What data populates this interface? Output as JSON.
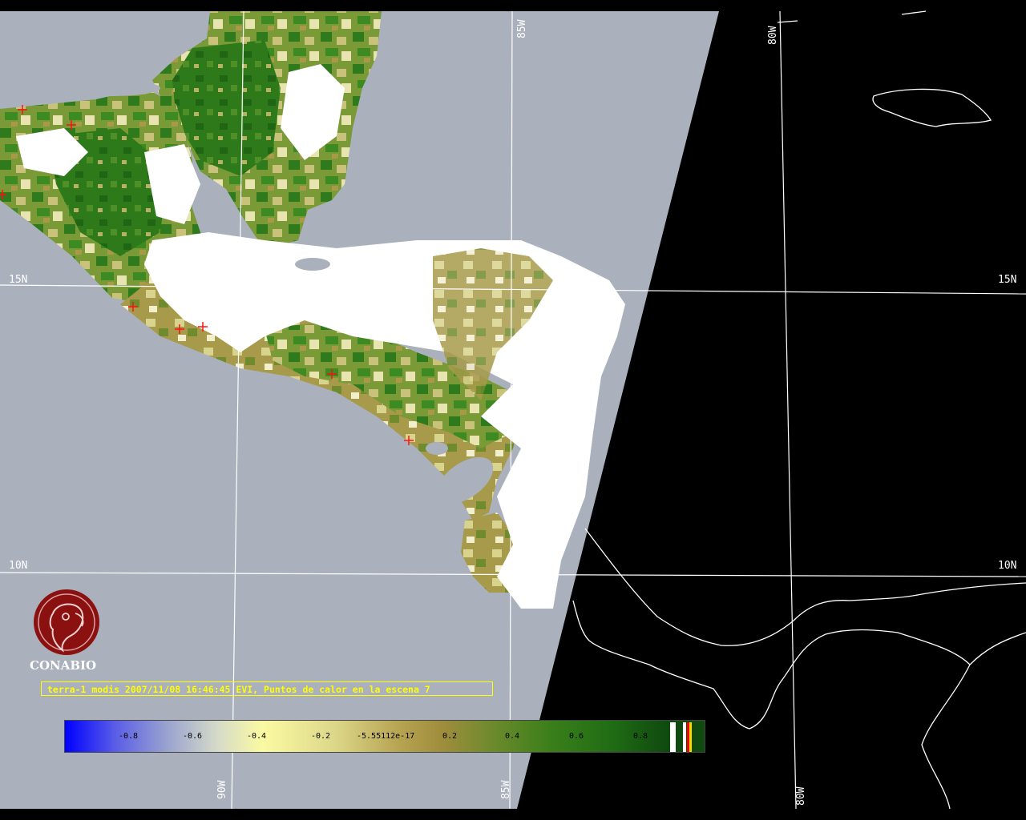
{
  "graticule": {
    "lat_labels": [
      "15N",
      "10N"
    ],
    "lon_labels": [
      "90W",
      "85W",
      "80W"
    ]
  },
  "logo": {
    "name": "CONABIO",
    "icon": "conabio-macaw-logo",
    "color": "#8b1010"
  },
  "caption": "terra-1 modis 2007/11/08 16:46:45 EVI, Puntos de calor en la escena 7",
  "colorbar": {
    "tick_labels": [
      "-0.8",
      "-0.6",
      "-0.4",
      "-0.2",
      "-5.55112e-17",
      "0.2",
      "0.4",
      "0.6",
      "0.8"
    ],
    "special_colors": [
      "#ffffff",
      "#000000",
      "#ff0000",
      "#ffd700"
    ]
  },
  "legend_colors": {
    "no_data": "#aab0bc",
    "cloud": "#ffffff",
    "night": "#000000",
    "hotspot": "#ff0000",
    "caption": "#ffff00"
  }
}
